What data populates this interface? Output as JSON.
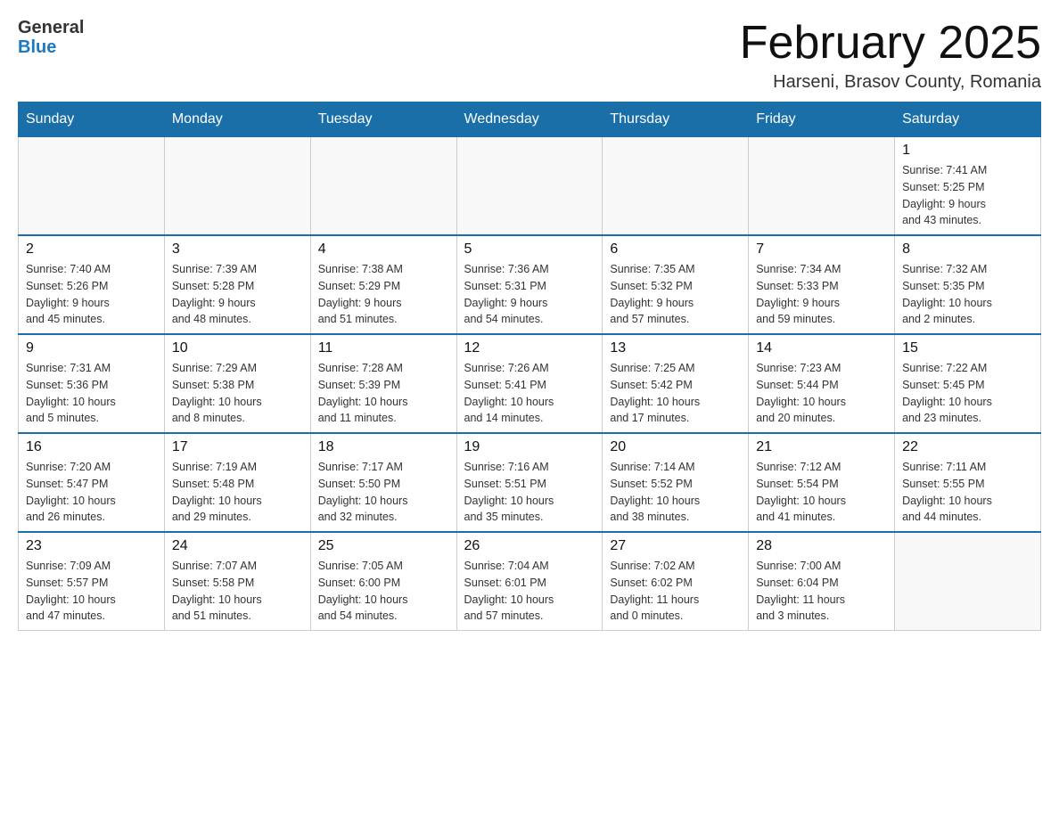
{
  "header": {
    "logo_text_general": "General",
    "logo_text_blue": "Blue",
    "month_title": "February 2025",
    "location": "Harseni, Brasov County, Romania"
  },
  "days_of_week": [
    "Sunday",
    "Monday",
    "Tuesday",
    "Wednesday",
    "Thursday",
    "Friday",
    "Saturday"
  ],
  "weeks": [
    [
      {
        "day": "",
        "info": ""
      },
      {
        "day": "",
        "info": ""
      },
      {
        "day": "",
        "info": ""
      },
      {
        "day": "",
        "info": ""
      },
      {
        "day": "",
        "info": ""
      },
      {
        "day": "",
        "info": ""
      },
      {
        "day": "1",
        "info": "Sunrise: 7:41 AM\nSunset: 5:25 PM\nDaylight: 9 hours\nand 43 minutes."
      }
    ],
    [
      {
        "day": "2",
        "info": "Sunrise: 7:40 AM\nSunset: 5:26 PM\nDaylight: 9 hours\nand 45 minutes."
      },
      {
        "day": "3",
        "info": "Sunrise: 7:39 AM\nSunset: 5:28 PM\nDaylight: 9 hours\nand 48 minutes."
      },
      {
        "day": "4",
        "info": "Sunrise: 7:38 AM\nSunset: 5:29 PM\nDaylight: 9 hours\nand 51 minutes."
      },
      {
        "day": "5",
        "info": "Sunrise: 7:36 AM\nSunset: 5:31 PM\nDaylight: 9 hours\nand 54 minutes."
      },
      {
        "day": "6",
        "info": "Sunrise: 7:35 AM\nSunset: 5:32 PM\nDaylight: 9 hours\nand 57 minutes."
      },
      {
        "day": "7",
        "info": "Sunrise: 7:34 AM\nSunset: 5:33 PM\nDaylight: 9 hours\nand 59 minutes."
      },
      {
        "day": "8",
        "info": "Sunrise: 7:32 AM\nSunset: 5:35 PM\nDaylight: 10 hours\nand 2 minutes."
      }
    ],
    [
      {
        "day": "9",
        "info": "Sunrise: 7:31 AM\nSunset: 5:36 PM\nDaylight: 10 hours\nand 5 minutes."
      },
      {
        "day": "10",
        "info": "Sunrise: 7:29 AM\nSunset: 5:38 PM\nDaylight: 10 hours\nand 8 minutes."
      },
      {
        "day": "11",
        "info": "Sunrise: 7:28 AM\nSunset: 5:39 PM\nDaylight: 10 hours\nand 11 minutes."
      },
      {
        "day": "12",
        "info": "Sunrise: 7:26 AM\nSunset: 5:41 PM\nDaylight: 10 hours\nand 14 minutes."
      },
      {
        "day": "13",
        "info": "Sunrise: 7:25 AM\nSunset: 5:42 PM\nDaylight: 10 hours\nand 17 minutes."
      },
      {
        "day": "14",
        "info": "Sunrise: 7:23 AM\nSunset: 5:44 PM\nDaylight: 10 hours\nand 20 minutes."
      },
      {
        "day": "15",
        "info": "Sunrise: 7:22 AM\nSunset: 5:45 PM\nDaylight: 10 hours\nand 23 minutes."
      }
    ],
    [
      {
        "day": "16",
        "info": "Sunrise: 7:20 AM\nSunset: 5:47 PM\nDaylight: 10 hours\nand 26 minutes."
      },
      {
        "day": "17",
        "info": "Sunrise: 7:19 AM\nSunset: 5:48 PM\nDaylight: 10 hours\nand 29 minutes."
      },
      {
        "day": "18",
        "info": "Sunrise: 7:17 AM\nSunset: 5:50 PM\nDaylight: 10 hours\nand 32 minutes."
      },
      {
        "day": "19",
        "info": "Sunrise: 7:16 AM\nSunset: 5:51 PM\nDaylight: 10 hours\nand 35 minutes."
      },
      {
        "day": "20",
        "info": "Sunrise: 7:14 AM\nSunset: 5:52 PM\nDaylight: 10 hours\nand 38 minutes."
      },
      {
        "day": "21",
        "info": "Sunrise: 7:12 AM\nSunset: 5:54 PM\nDaylight: 10 hours\nand 41 minutes."
      },
      {
        "day": "22",
        "info": "Sunrise: 7:11 AM\nSunset: 5:55 PM\nDaylight: 10 hours\nand 44 minutes."
      }
    ],
    [
      {
        "day": "23",
        "info": "Sunrise: 7:09 AM\nSunset: 5:57 PM\nDaylight: 10 hours\nand 47 minutes."
      },
      {
        "day": "24",
        "info": "Sunrise: 7:07 AM\nSunset: 5:58 PM\nDaylight: 10 hours\nand 51 minutes."
      },
      {
        "day": "25",
        "info": "Sunrise: 7:05 AM\nSunset: 6:00 PM\nDaylight: 10 hours\nand 54 minutes."
      },
      {
        "day": "26",
        "info": "Sunrise: 7:04 AM\nSunset: 6:01 PM\nDaylight: 10 hours\nand 57 minutes."
      },
      {
        "day": "27",
        "info": "Sunrise: 7:02 AM\nSunset: 6:02 PM\nDaylight: 11 hours\nand 0 minutes."
      },
      {
        "day": "28",
        "info": "Sunrise: 7:00 AM\nSunset: 6:04 PM\nDaylight: 11 hours\nand 3 minutes."
      },
      {
        "day": "",
        "info": ""
      }
    ]
  ]
}
